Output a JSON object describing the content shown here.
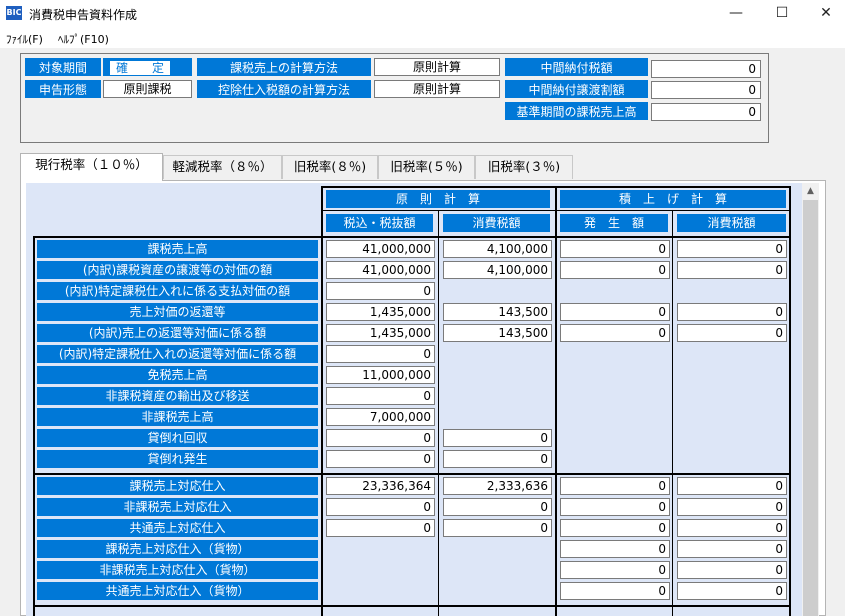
{
  "window": {
    "icon_text": "BIC",
    "title": "消費税申告資料作成",
    "minimize": "—",
    "maximize": "☐",
    "close": "✕"
  },
  "menu": [
    {
      "label": "ﾌｧｲﾙ(F)"
    },
    {
      "label": "ﾍﾙﾌﾟ(F10)"
    }
  ],
  "header": {
    "period_label": "対象期間",
    "period_value": "確　　定",
    "filing_label": "申告形態",
    "filing_value": "原則課税",
    "sales_method_label": "課税売上の計算方法",
    "sales_method_value": "原則計算",
    "deduction_method_label": "控除仕入税額の計算方法",
    "deduction_method_value": "原則計算",
    "interim_tax_label": "中間納付税額",
    "interim_tax_value": "0",
    "interim_transfer_label": "中間納付譲渡割額",
    "interim_transfer_value": "0",
    "base_sales_label": "基準期間の課税売上高",
    "base_sales_value": "0"
  },
  "tabs": [
    {
      "label": "現行税率（１０％）",
      "active": true
    },
    {
      "label": "軽減税率（８％）",
      "active": false
    },
    {
      "label": "旧税率(８％)",
      "active": false
    },
    {
      "label": "旧税率(５％)",
      "active": false
    },
    {
      "label": "旧税率(３％)",
      "active": false
    }
  ],
  "columns": {
    "principle_group": "原　則　計　算",
    "accum_group": "積　上　げ　計　算",
    "col1": "税込・税抜額",
    "col2": "消費税額",
    "col3": "発　生　額",
    "col4": "消費税額"
  },
  "sales_rows": [
    {
      "label": "課税売上高",
      "c1": "41,000,000",
      "c2": "4,100,000",
      "c3": "0",
      "c4": "0"
    },
    {
      "label": "(内訳)課税資産の譲渡等の対価の額",
      "c1": "41,000,000",
      "c2": "4,100,000",
      "c3": "0",
      "c4": "0"
    },
    {
      "label": "(内訳)特定課税仕入れに係る支払対価の額",
      "c1": "0",
      "c2": null,
      "c3": null,
      "c4": null
    },
    {
      "label": "売上対価の返還等",
      "c1": "1,435,000",
      "c2": "143,500",
      "c3": "0",
      "c4": "0"
    },
    {
      "label": "(内訳)売上の返還等対価に係る額",
      "c1": "1,435,000",
      "c2": "143,500",
      "c3": "0",
      "c4": "0"
    },
    {
      "label": "(内訳)特定課税仕入れの返還等対価に係る額",
      "c1": "0",
      "c2": null,
      "c3": null,
      "c4": null
    },
    {
      "label": "免税売上高",
      "c1": "11,000,000",
      "c2": null,
      "c3": null,
      "c4": null
    },
    {
      "label": "非課税資産の輸出及び移送",
      "c1": "0",
      "c2": null,
      "c3": null,
      "c4": null
    },
    {
      "label": "非課税売上高",
      "c1": "7,000,000",
      "c2": null,
      "c3": null,
      "c4": null
    },
    {
      "label": "貸倒れ回収",
      "c1": "0",
      "c2": "0",
      "c3": null,
      "c4": null
    },
    {
      "label": "貸倒れ発生",
      "c1": "0",
      "c2": "0",
      "c3": null,
      "c4": null
    }
  ],
  "purchase_rows": [
    {
      "label": "課税売上対応仕入",
      "c1": "23,336,364",
      "c2": "2,333,636",
      "c3": "0",
      "c4": "0"
    },
    {
      "label": "非課税売上対応仕入",
      "c1": "0",
      "c2": "0",
      "c3": "0",
      "c4": "0"
    },
    {
      "label": "共通売上対応仕入",
      "c1": "0",
      "c2": "0",
      "c3": "0",
      "c4": "0"
    },
    {
      "label": "課税売上対応仕入（貨物）",
      "c1": null,
      "c2": null,
      "c3": "0",
      "c4": "0"
    },
    {
      "label": "非課税売上対応仕入（貨物）",
      "c1": null,
      "c2": null,
      "c3": "0",
      "c4": "0"
    },
    {
      "label": "共通売上対応仕入（貨物）",
      "c1": null,
      "c2": null,
      "c3": "0",
      "c4": "0"
    }
  ]
}
